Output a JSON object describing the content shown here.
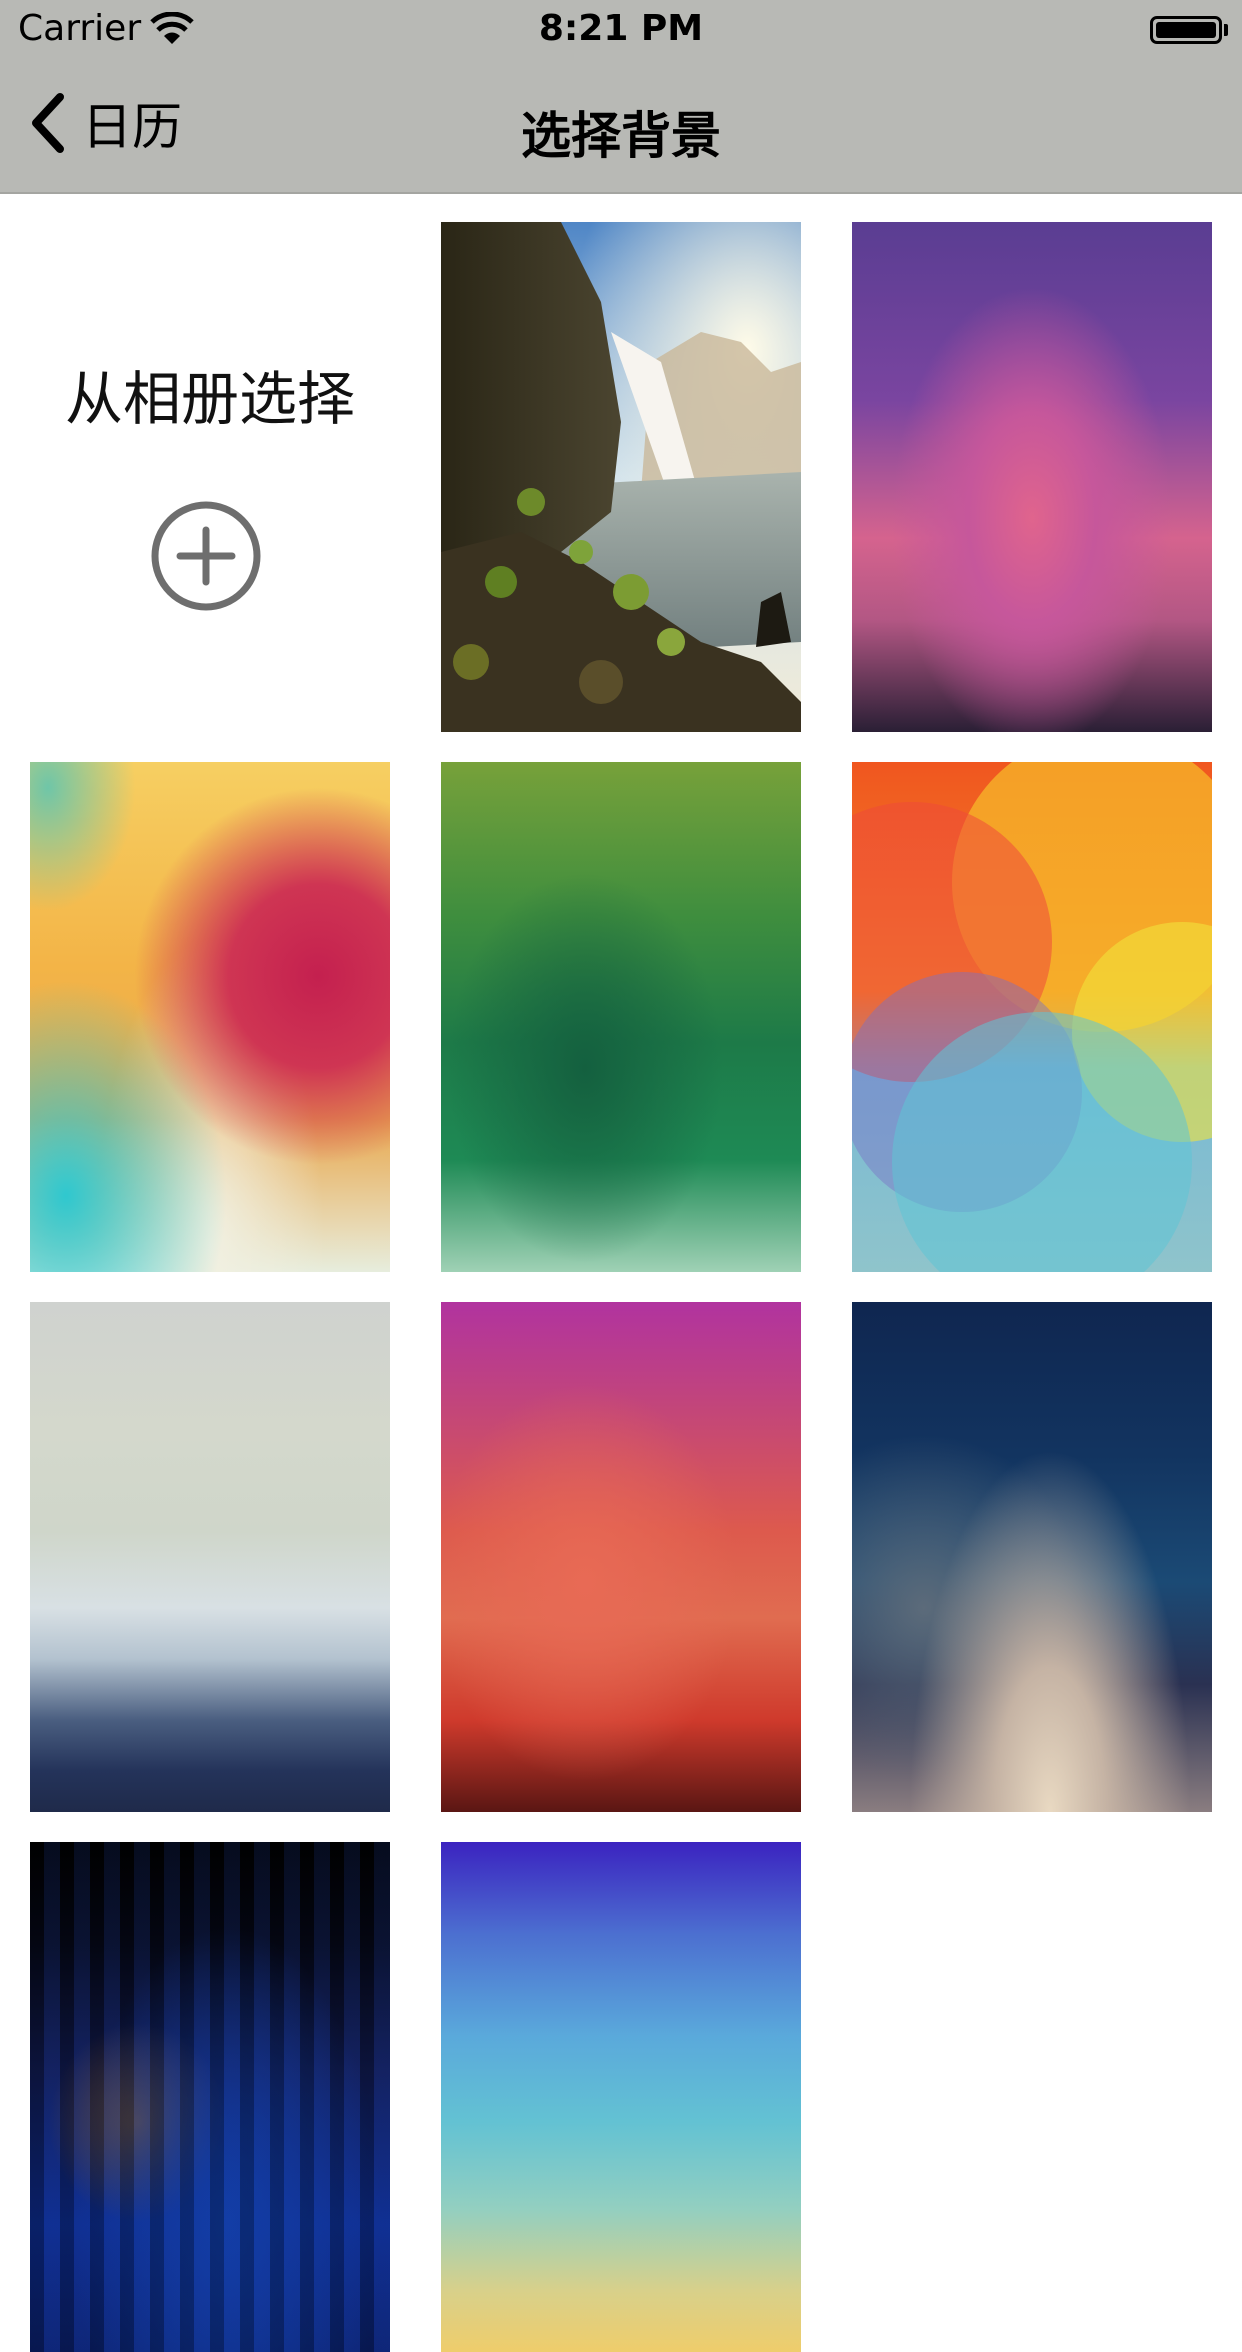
{
  "status_bar": {
    "carrier": "Carrier",
    "time": "8:21 PM"
  },
  "nav": {
    "back_label": "日历",
    "title": "选择背景"
  },
  "album": {
    "label": "从相册选择",
    "icon": "plus-circle-icon"
  },
  "wallpapers": [
    {
      "id": "waterfall",
      "style": "photo"
    },
    {
      "id": "purple-pink-gradient",
      "colors": [
        "#5a3d92",
        "#d7628e",
        "#2a1f35"
      ]
    },
    {
      "id": "yellow-red-blur",
      "colors": [
        "#f2b64a",
        "#c4204f",
        "#2fc8cf"
      ]
    },
    {
      "id": "green-gradient",
      "colors": [
        "#6f9e3c",
        "#1e6c45",
        "#8ecaaa"
      ]
    },
    {
      "id": "orange-petal-swirl",
      "colors": [
        "#ef4e1f",
        "#f7b82a",
        "#58c5d2"
      ]
    },
    {
      "id": "grey-navy-fade",
      "colors": [
        "#cfd2cf",
        "#cdd9dc",
        "#1c2a4c"
      ]
    },
    {
      "id": "magenta-red-gradient",
      "colors": [
        "#b23aa4",
        "#e06a54",
        "#4a1414"
      ]
    },
    {
      "id": "navy-blue-glow",
      "colors": [
        "#0f2650",
        "#1b4a75",
        "#e6d6c2"
      ]
    },
    {
      "id": "dark-blue-stripes",
      "colors": [
        "#000000",
        "#0e2e8c",
        "#3a1040"
      ]
    },
    {
      "id": "blue-teal-yellow",
      "colors": [
        "#3b23c0",
        "#5cb8d8",
        "#f0d070"
      ]
    }
  ]
}
